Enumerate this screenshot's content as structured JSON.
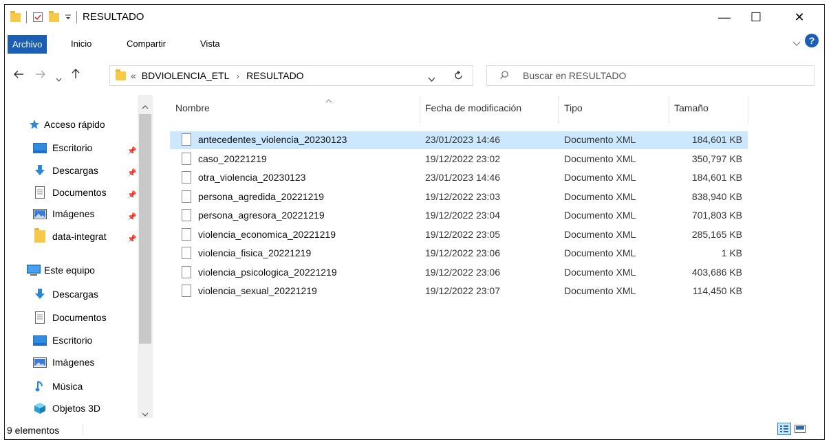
{
  "window": {
    "title": "RESULTADO",
    "controls": {
      "minimize": "—",
      "maximize": "☐",
      "close": "✕"
    }
  },
  "ribbon": {
    "tabs": [
      "Archivo",
      "Inicio",
      "Compartir",
      "Vista"
    ],
    "expand_icon": "chevron-down",
    "help": "?"
  },
  "address": {
    "overflow": "«",
    "path": [
      "BDVIOLENCIA_ETL",
      "RESULTADO"
    ],
    "separator": "›",
    "search_placeholder": "Buscar en RESULTADO"
  },
  "sidebar": {
    "quick_access": "Acceso rápido",
    "quick_items": [
      "Escritorio",
      "Descargas",
      "Documentos",
      "Imágenes",
      "data-integrat"
    ],
    "this_pc": "Este equipo",
    "pc_items": [
      "Descargas",
      "Documentos",
      "Escritorio",
      "Imágenes",
      "Música",
      "Objetos 3D"
    ]
  },
  "columns": {
    "name": "Nombre",
    "modified": "Fecha de modificación",
    "type": "Tipo",
    "size": "Tamaño"
  },
  "files": [
    {
      "name": "antecedentes_violencia_20230123",
      "modified": "23/01/2023 14:46",
      "type": "Documento XML",
      "size": "184,601 KB",
      "selected": true
    },
    {
      "name": "caso_20221219",
      "modified": "19/12/2022 23:02",
      "type": "Documento XML",
      "size": "350,797 KB"
    },
    {
      "name": "otra_violencia_20230123",
      "modified": "23/01/2023 14:46",
      "type": "Documento XML",
      "size": "184,601 KB"
    },
    {
      "name": "persona_agredida_20221219",
      "modified": "19/12/2022 23:03",
      "type": "Documento XML",
      "size": "838,940 KB"
    },
    {
      "name": "persona_agresora_20221219",
      "modified": "19/12/2022 23:04",
      "type": "Documento XML",
      "size": "701,803 KB"
    },
    {
      "name": "violencia_economica_20221219",
      "modified": "19/12/2022 23:05",
      "type": "Documento XML",
      "size": "285,165 KB"
    },
    {
      "name": "violencia_fisica_20221219",
      "modified": "19/12/2022 23:06",
      "type": "Documento XML",
      "size": "1 KB"
    },
    {
      "name": "violencia_psicologica_20221219",
      "modified": "19/12/2022 23:06",
      "type": "Documento XML",
      "size": "403,686 KB"
    },
    {
      "name": "violencia_sexual_20221219",
      "modified": "19/12/2022 23:07",
      "type": "Documento XML",
      "size": "114,450 KB"
    }
  ],
  "status": {
    "count": "9 elementos"
  },
  "colors": {
    "accent": "#1a5fb4",
    "selection": "#cce8ff",
    "folder": "#f7c948"
  }
}
